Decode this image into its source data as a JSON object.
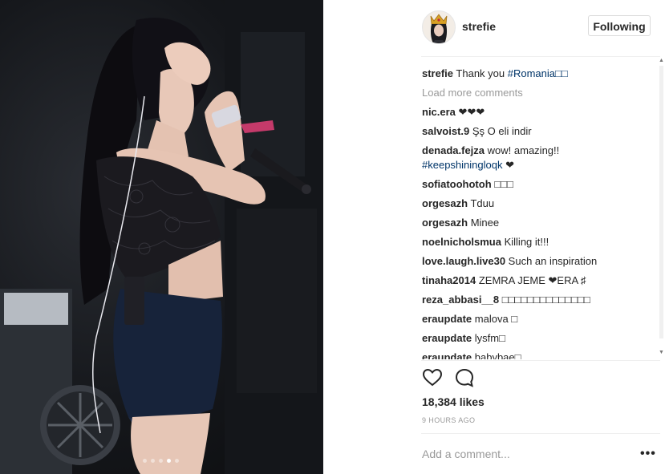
{
  "post": {
    "username": "strefie",
    "follow_label": "Following",
    "carousel": {
      "count": 5,
      "active_index": 3
    }
  },
  "comments": [
    {
      "user": "strefie",
      "text": "Thank you ",
      "tag": "#Romania□□"
    },
    {
      "user": "nic.era",
      "text": "❤❤❤"
    },
    {
      "user": "salvoist.9",
      "text": "Şş O eli indir"
    },
    {
      "user": "denada.fejza",
      "text": "wow! amazing!! ",
      "tag": "#keepshiningloqk",
      "suffix": " ❤"
    },
    {
      "user": "sofiatoohotoh",
      "text": "□□□"
    },
    {
      "user": "orgesazh",
      "text": "Tduu"
    },
    {
      "user": "orgesazh",
      "text": "Minee"
    },
    {
      "user": "noelnicholsmua",
      "text": "Killing it!!!"
    },
    {
      "user": "love.laugh.live30",
      "text": "Such an inspiration"
    },
    {
      "user": "tinaha2014",
      "text": "ZEMRA JEME ❤ERA ♯"
    },
    {
      "user": "reza_abbasi__8",
      "text": "□□□□□□□□□□□□□□"
    },
    {
      "user": "eraupdate",
      "text": "malova □"
    },
    {
      "user": "eraupdate",
      "text": "lysfm□"
    },
    {
      "user": "eraupdate",
      "text": "babybae□"
    }
  ],
  "load_more_label": "Load more comments",
  "likes_text": "18,384 likes",
  "time_text": "9 HOURS AGO",
  "add_comment_placeholder": "Add a comment...",
  "more_label": "•••",
  "icons": {
    "like": "heart-icon",
    "comment": "comment-bubble-icon",
    "options": "more-options-icon"
  },
  "colors": {
    "hashtag": "#003569",
    "muted": "#999999",
    "text": "#262626",
    "border": "#dbdbdb"
  }
}
